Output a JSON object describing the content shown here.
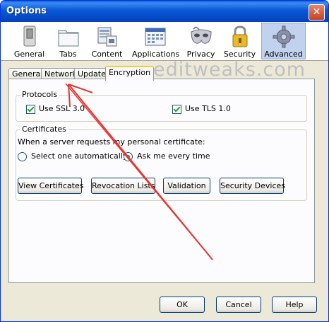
{
  "window": {
    "title": "Options",
    "close_glyph": "✕"
  },
  "toolbar": {
    "items": [
      {
        "label": "General",
        "icon": "switch-icon"
      },
      {
        "label": "Tabs",
        "icon": "tabs-folder-icon"
      },
      {
        "label": "Content",
        "icon": "content-icon"
      },
      {
        "label": "Applications",
        "icon": "applications-icon"
      },
      {
        "label": "Privacy",
        "icon": "mask-icon"
      },
      {
        "label": "Security",
        "icon": "padlock-icon"
      },
      {
        "label": "Advanced",
        "icon": "gear-icon",
        "selected": true
      }
    ]
  },
  "watermark": "editweaks.com",
  "tabs": [
    {
      "label": "General"
    },
    {
      "label": "Network"
    },
    {
      "label": "Update"
    },
    {
      "label": "Encryption",
      "active": true
    }
  ],
  "protocols": {
    "legend": "Protocols",
    "ssl_label": "Use SSL 3.0",
    "ssl_checked": true,
    "tls_label": "Use TLS 1.0",
    "tls_checked": true
  },
  "certificates": {
    "legend": "Certificates",
    "prompt": "When a server requests my personal certificate:",
    "option_auto": "Select one automatically",
    "option_ask": "Ask me every time",
    "selected": "Ask me every time",
    "buttons": {
      "view": "View Certificates",
      "revocation": "Revocation Lists",
      "validation": "Validation",
      "devices": "Security Devices"
    }
  },
  "footer": {
    "ok": "OK",
    "cancel": "Cancel",
    "help": "Help"
  },
  "colors": {
    "titlebar": "#0a58d6",
    "annotation_arrow": "#e8332e",
    "selected_toolbar": "#c1d2ee",
    "check_mark": "#21a121"
  }
}
